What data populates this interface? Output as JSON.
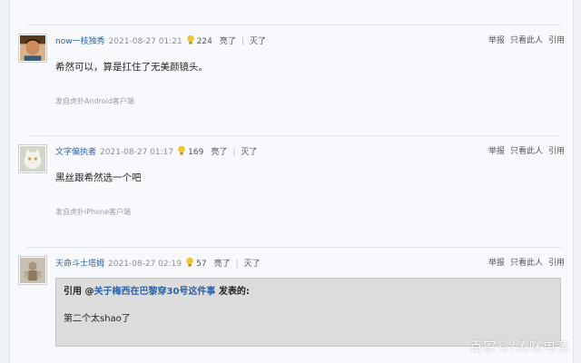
{
  "posts": [
    {
      "username": "now一枝独秀",
      "time": "2021-08-27 01:21",
      "lights": "224",
      "light_label": "亮了",
      "dim_label": "灭了",
      "content": "希然可以，算是扛住了无美颜镜头。",
      "source": "发自虎扑Android客户端",
      "avatar_icon": "user-photo-avatar"
    },
    {
      "username": "文字偏执者",
      "time": "2021-08-27 01:17",
      "lights": "169",
      "light_label": "亮了",
      "dim_label": "灭了",
      "content": "黑丝跟希然选一个吧",
      "source": "发自虎扑iPhone客户端",
      "avatar_icon": "white-cat-avatar"
    },
    {
      "username": "天命斗士塔姆",
      "time": "2021-08-27 02:19",
      "lights": "57",
      "light_label": "亮了",
      "dim_label": "灭了",
      "avatar_icon": "figure-avatar",
      "quote": {
        "prefix": "引用 @",
        "link": "关于梅西在巴黎穿30号这件事",
        "suffix": " 发表的:",
        "body": "第二个太shao了"
      }
    }
  ],
  "actions": {
    "report": "举报",
    "only_this": "只看此人",
    "cite": "引用"
  },
  "watermark": "百家号/涛咪电竞",
  "colors": {
    "username": "#2a63a8",
    "background": "#f7f9fc",
    "quote_bg": "#dcdcdc"
  }
}
